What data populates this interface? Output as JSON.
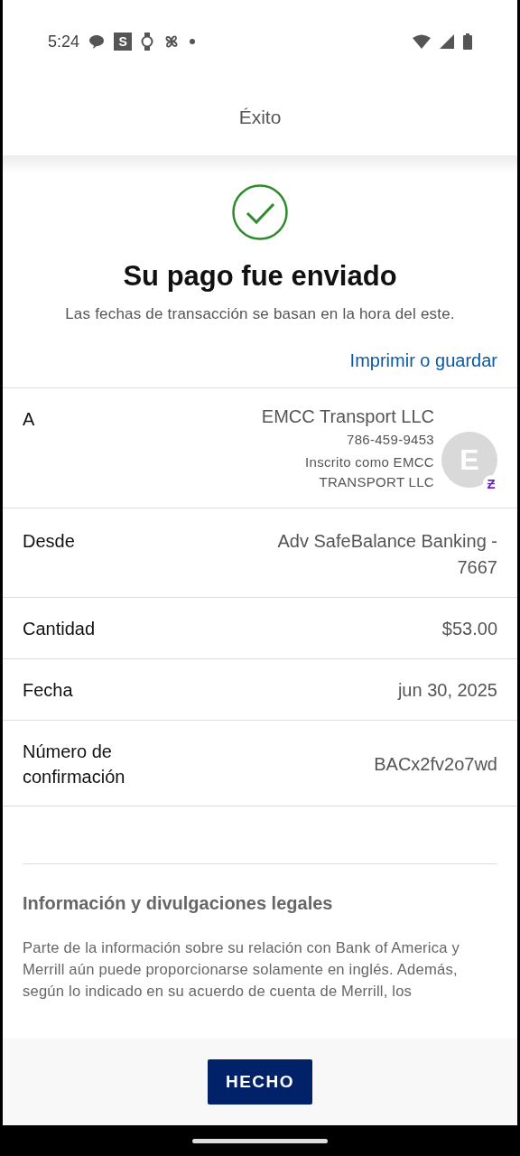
{
  "status_bar": {
    "time": "5:24",
    "app_badge": "S"
  },
  "header": {
    "title": "Éxito"
  },
  "hero": {
    "title": "Su pago fue enviado",
    "subtitle": "Las fechas de transacción se basan en la hora del este.",
    "link": "Imprimir o guardar"
  },
  "details": [
    {
      "kind": "recipient",
      "label": "A",
      "name": "EMCC Transport LLC",
      "phone": "786-459-9453",
      "note": "Inscrito como EMCC TRANSPORT LLC",
      "avatar": "E",
      "badge": "Ƶ"
    },
    {
      "kind": "plain",
      "label": "Desde",
      "value": "Adv SafeBalance Banking - 7667"
    },
    {
      "kind": "plain",
      "label": "Cantidad",
      "value": "$53.00"
    },
    {
      "kind": "plain",
      "label": "Fecha",
      "value": "jun 30, 2025"
    },
    {
      "kind": "plain",
      "label": "Número de confirmación",
      "value": "BACx2fv2o7wd"
    }
  ],
  "legal": {
    "title": "Información y divulgaciones legales",
    "text": "Parte de la información sobre su relación con Bank of America y Merrill aún puede proporcionarse solamente en inglés. Además, según lo indicado en su acuerdo de cuenta de Merrill, los"
  },
  "footer": {
    "button": "HECHO"
  }
}
